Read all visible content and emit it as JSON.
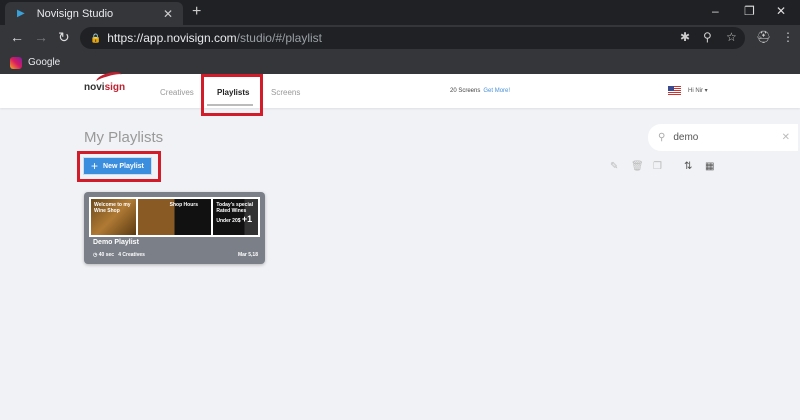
{
  "browser": {
    "tab_title": "Novisign Studio",
    "url_host": "https://app.novisign.com",
    "url_path": "/studio/#/playlist",
    "bookmark": "Google"
  },
  "header": {
    "logo": {
      "part1": "novi",
      "part2": "sign"
    },
    "menu": [
      {
        "label": "Creatives"
      },
      {
        "label": "Playlists",
        "active": true
      },
      {
        "label": "Screens"
      }
    ],
    "screens_text": "20 Screens",
    "get_more": "Get More!",
    "user": "Hi Nir"
  },
  "page": {
    "title": "My Playlists",
    "new_playlist": "New Playlist",
    "search_value": "demo"
  },
  "playlists": [
    {
      "name": "Demo Playlist",
      "duration": "40 sec",
      "creatives": "4 Creatives",
      "date": "Mar 5,18",
      "thumbs": [
        "Welcome to my Wine Shop",
        "Shop Hours",
        "Today's special Rated Wines Under 20$"
      ],
      "more": "+1"
    }
  ],
  "colors": {
    "accent": "#3b8ede",
    "highlight": "#d21c2a",
    "brand": "#c0202f"
  }
}
